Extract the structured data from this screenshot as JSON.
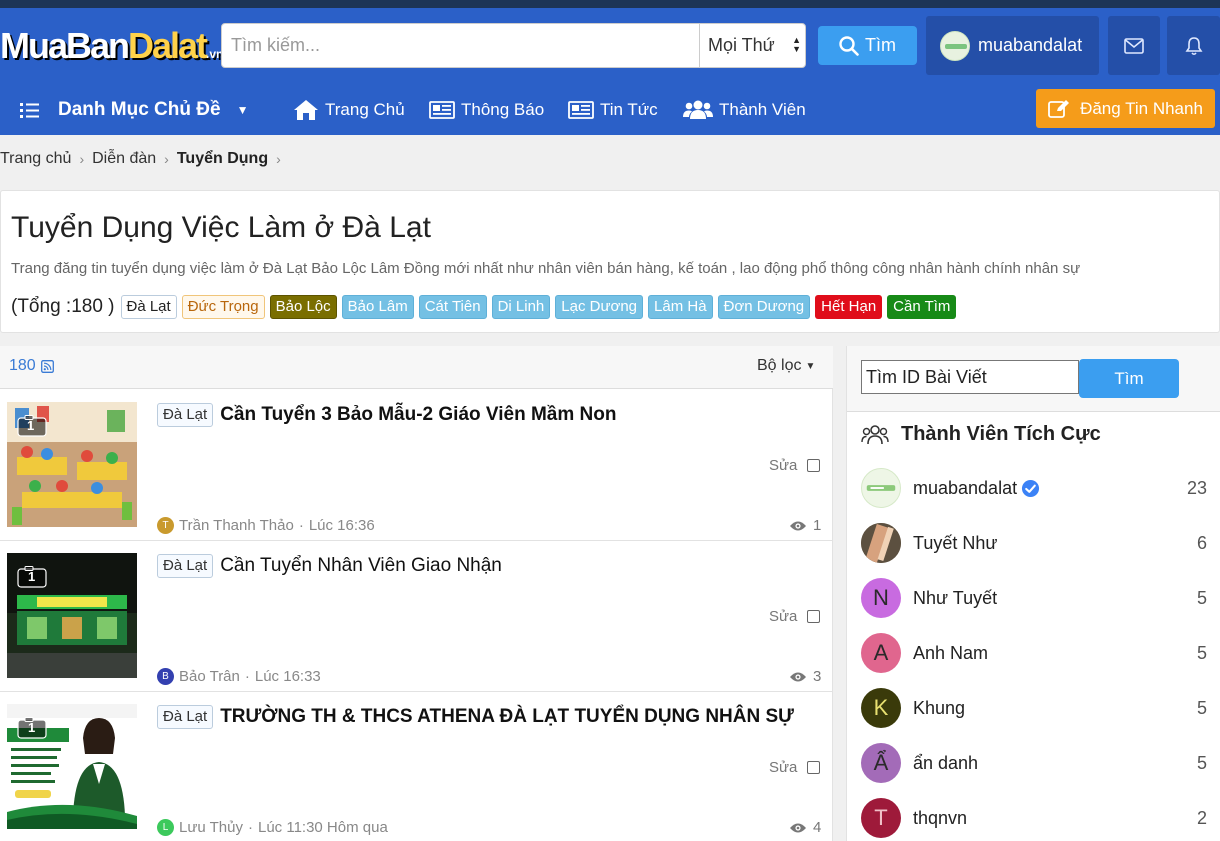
{
  "logo": {
    "main": "MuaBan",
    "accent": "Dalat",
    "suffix": ".vn"
  },
  "search": {
    "placeholder": "Tìm kiếm...",
    "scope": "Mọi Thứ",
    "button": "Tìm"
  },
  "user": {
    "name": "muabandalat"
  },
  "nav": {
    "category": "Danh Mục Chủ Đề",
    "items": [
      "Trang Chủ",
      "Thông Báo",
      "Tin Tức",
      "Thành Viên"
    ],
    "post_button": "Đăng Tin Nhanh"
  },
  "breadcrumb": {
    "items": [
      "Trang chủ",
      "Diễn đàn",
      "Tuyển Dụng"
    ]
  },
  "forum": {
    "title": "Tuyển Dụng Việc Làm ở Đà Lạt",
    "description": "Trang đăng tin tuyển dụng việc làm ở Đà Lạt Bảo Lộc Lâm Đồng mới nhất như nhân viên bán hàng, kế toán , lao động phổ thông công nhân hành chính nhân sự",
    "total": "(Tổng :180 )",
    "tags": [
      "Đà Lạt",
      "Đức Trọng",
      "Bảo Lộc",
      "Bảo Lâm",
      "Cát Tiên",
      "Di Linh",
      "Lạc Dương",
      "Lâm Hà",
      "Đơn Dương",
      "Hết Hạn",
      "Cần Tìm"
    ]
  },
  "list": {
    "count": "180",
    "filter": "Bộ lọc",
    "threads": [
      {
        "prefix": "Đà Lạt",
        "title": "Cần Tuyển 3 Bảo Mẫu-2 Giáo Viên Mầm Non",
        "images": "1",
        "edit": "Sửa",
        "author_initial": "T",
        "author": "Trần Thanh Thảo",
        "time": "Lúc 16:36",
        "views": "1"
      },
      {
        "prefix": "Đà Lạt",
        "title": "Cần Tuyển Nhân Viên Giao Nhận",
        "images": "1",
        "edit": "Sửa",
        "author_initial": "B",
        "author": "Bảo Trân",
        "time": "Lúc 16:33",
        "views": "3"
      },
      {
        "prefix": "Đà Lạt",
        "title": "TRƯỜNG TH & THCS ATHENA ĐÀ LẠT TUYỂN DỤNG NHÂN SỰ",
        "images": "1",
        "edit": "Sửa",
        "author_initial": "L",
        "author": "Lưu Thủy",
        "time": "Lúc 11:30 Hôm qua",
        "views": "4"
      }
    ]
  },
  "sidebar": {
    "id_placeholder": "Tìm ID Bài Viết",
    "id_button": "Tìm",
    "title": "Thành Viên Tích Cực",
    "members": [
      {
        "name": "muabandalat",
        "count": "23",
        "initial": ""
      },
      {
        "name": "Tuyết Như",
        "count": "6",
        "initial": ""
      },
      {
        "name": "Như Tuyết",
        "count": "5",
        "initial": "N"
      },
      {
        "name": "Anh Nam",
        "count": "5",
        "initial": "A"
      },
      {
        "name": "Khung",
        "count": "5",
        "initial": "K"
      },
      {
        "name": "ẩn danh",
        "count": "5",
        "initial": "Ẩ"
      },
      {
        "name": "thqnvn",
        "count": "2",
        "initial": "T"
      }
    ]
  },
  "colors": {
    "header": "#2b60c8",
    "accent_button": "#3b9ef0",
    "post_button": "#f59c1a"
  }
}
